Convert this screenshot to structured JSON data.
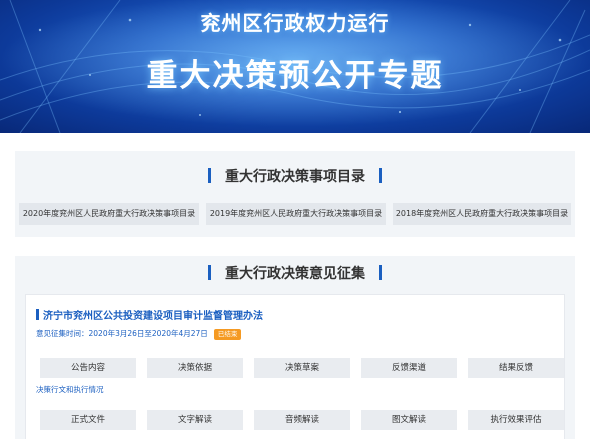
{
  "banner": {
    "title_line1": "兖州区行政权力运行",
    "title_line2": "重大决策预公开专题"
  },
  "section_catalog": {
    "title": "重大行政决策事项目录",
    "items": [
      "2020年度兖州区人民政府重大行政决策事项目录",
      "2019年度兖州区人民政府重大行政决策事项目录",
      "2018年度兖州区人民政府重大行政决策事项目录"
    ]
  },
  "section_opinion": {
    "title": "重大行政决策意见征集",
    "card": {
      "title": "济宁市兖州区公共投资建设项目审计监督管理办法",
      "period": "意见征集时间：2020年3月26日至2020年4月27日",
      "status_badge": "已结束",
      "tabs_row1": [
        "公告内容",
        "决策依据",
        "决策草案",
        "反馈渠道",
        "结果反馈"
      ],
      "subheading": "决策行文和执行情况",
      "tabs_row2": [
        "正式文件",
        "文字解读",
        "音频解读",
        "图文解读",
        "执行效果评估"
      ]
    }
  },
  "colors": {
    "accent": "#1b5fc0",
    "badge": "#f59a23",
    "panel_bg": "#f2f5f8"
  }
}
